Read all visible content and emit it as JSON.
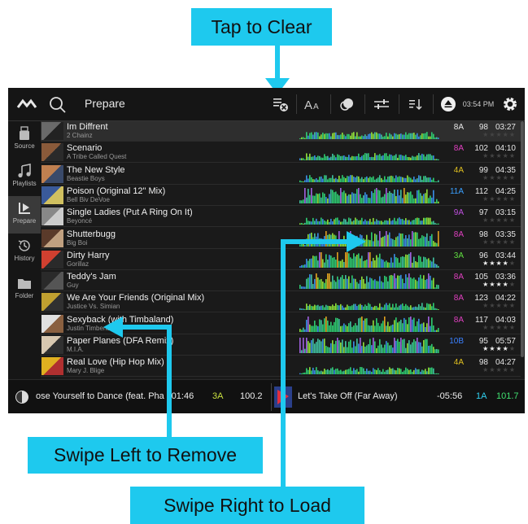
{
  "callouts": {
    "tap_to_clear": "Tap to Clear",
    "swipe_left": "Swipe Left to Remove",
    "swipe_right": "Swipe Right to Load"
  },
  "header": {
    "title": "Prepare",
    "clock": "03:54 PM",
    "icons": [
      "app-logo-icon",
      "search-icon",
      "clear-list-icon",
      "font-size-icon",
      "color-filter-icon",
      "filter-sliders-icon",
      "sort-icon",
      "eject-icon",
      "gear-icon"
    ]
  },
  "sidebar": {
    "items": [
      {
        "label": "Source",
        "icon": "usb-drive-icon"
      },
      {
        "label": "Playlists",
        "icon": "music-note-icon"
      },
      {
        "label": "Prepare",
        "icon": "prepare-icon",
        "active": true
      },
      {
        "label": "History",
        "icon": "history-icon"
      },
      {
        "label": "Folder",
        "icon": "folder-icon"
      }
    ]
  },
  "tracks": [
    {
      "title": "Im Diffrent",
      "artist": "2 Chainz",
      "key": "8A",
      "key_color": "#e8e8e8",
      "bpm": "98",
      "time": "03:27",
      "rating": 0
    },
    {
      "title": "Scenario",
      "artist": "A Tribe Called Quest",
      "key": "8A",
      "key_color": "#e040c0",
      "bpm": "102",
      "time": "04:10",
      "rating": 0
    },
    {
      "title": "The New Style",
      "artist": "Beastie Boys",
      "key": "4A",
      "key_color": "#e0c020",
      "bpm": "99",
      "time": "04:35",
      "rating": 0
    },
    {
      "title": "Poison (Original 12\" Mix)",
      "artist": "Bell Biv DeVoe",
      "key": "11A",
      "key_color": "#3aa0ff",
      "bpm": "112",
      "time": "04:25",
      "rating": 0
    },
    {
      "title": "Single Ladies (Put A Ring On It)",
      "artist": "Beyoncé",
      "key": "9A",
      "key_color": "#c050e0",
      "bpm": "97",
      "time": "03:15",
      "rating": 0
    },
    {
      "title": "Shutterbugg",
      "artist": "Big Boi",
      "key": "8A",
      "key_color": "#e040c0",
      "bpm": "98",
      "time": "03:35",
      "rating": 0
    },
    {
      "title": "Dirty Harry",
      "artist": "Gorillaz",
      "key": "3A",
      "key_color": "#60e040",
      "bpm": "96",
      "time": "03:44",
      "rating": 4
    },
    {
      "title": "Teddy's Jam",
      "artist": "Guy",
      "key": "8A",
      "key_color": "#e040c0",
      "bpm": "105",
      "time": "03:36",
      "rating": 4
    },
    {
      "title": "We Are Your Friends (Original Mix)",
      "artist": "Justice Vs. Simian",
      "key": "8A",
      "key_color": "#e040c0",
      "bpm": "123",
      "time": "04:22",
      "rating": 0
    },
    {
      "title": "Sexyback (with Timbaland)",
      "artist": "Justin Timberlake",
      "key": "8A",
      "key_color": "#e040c0",
      "bpm": "117",
      "time": "04:03",
      "rating": 0
    },
    {
      "title": "Paper Planes (DFA Remix)",
      "artist": "M.I.A.",
      "key": "10B",
      "key_color": "#3a80ff",
      "bpm": "95",
      "time": "05:57",
      "rating": 4
    },
    {
      "title": "Real Love (Hip Hop Mix)",
      "artist": "Mary J. Blige",
      "key": "4A",
      "key_color": "#e0c020",
      "bpm": "98",
      "time": "04:27",
      "rating": 0
    }
  ],
  "deck_left": {
    "title": "ose Yourself to Dance (feat. Pha",
    "remaining": "-01:46",
    "key": "3A",
    "key_color": "#c8e040",
    "bpm": "100.2"
  },
  "deck_right": {
    "title": "Let's Take Off (Far Away)",
    "remaining": "-05:56",
    "key": "1A",
    "key_color": "#30d0f0",
    "bpm": "101.7",
    "bpm_color": "#40e070"
  }
}
